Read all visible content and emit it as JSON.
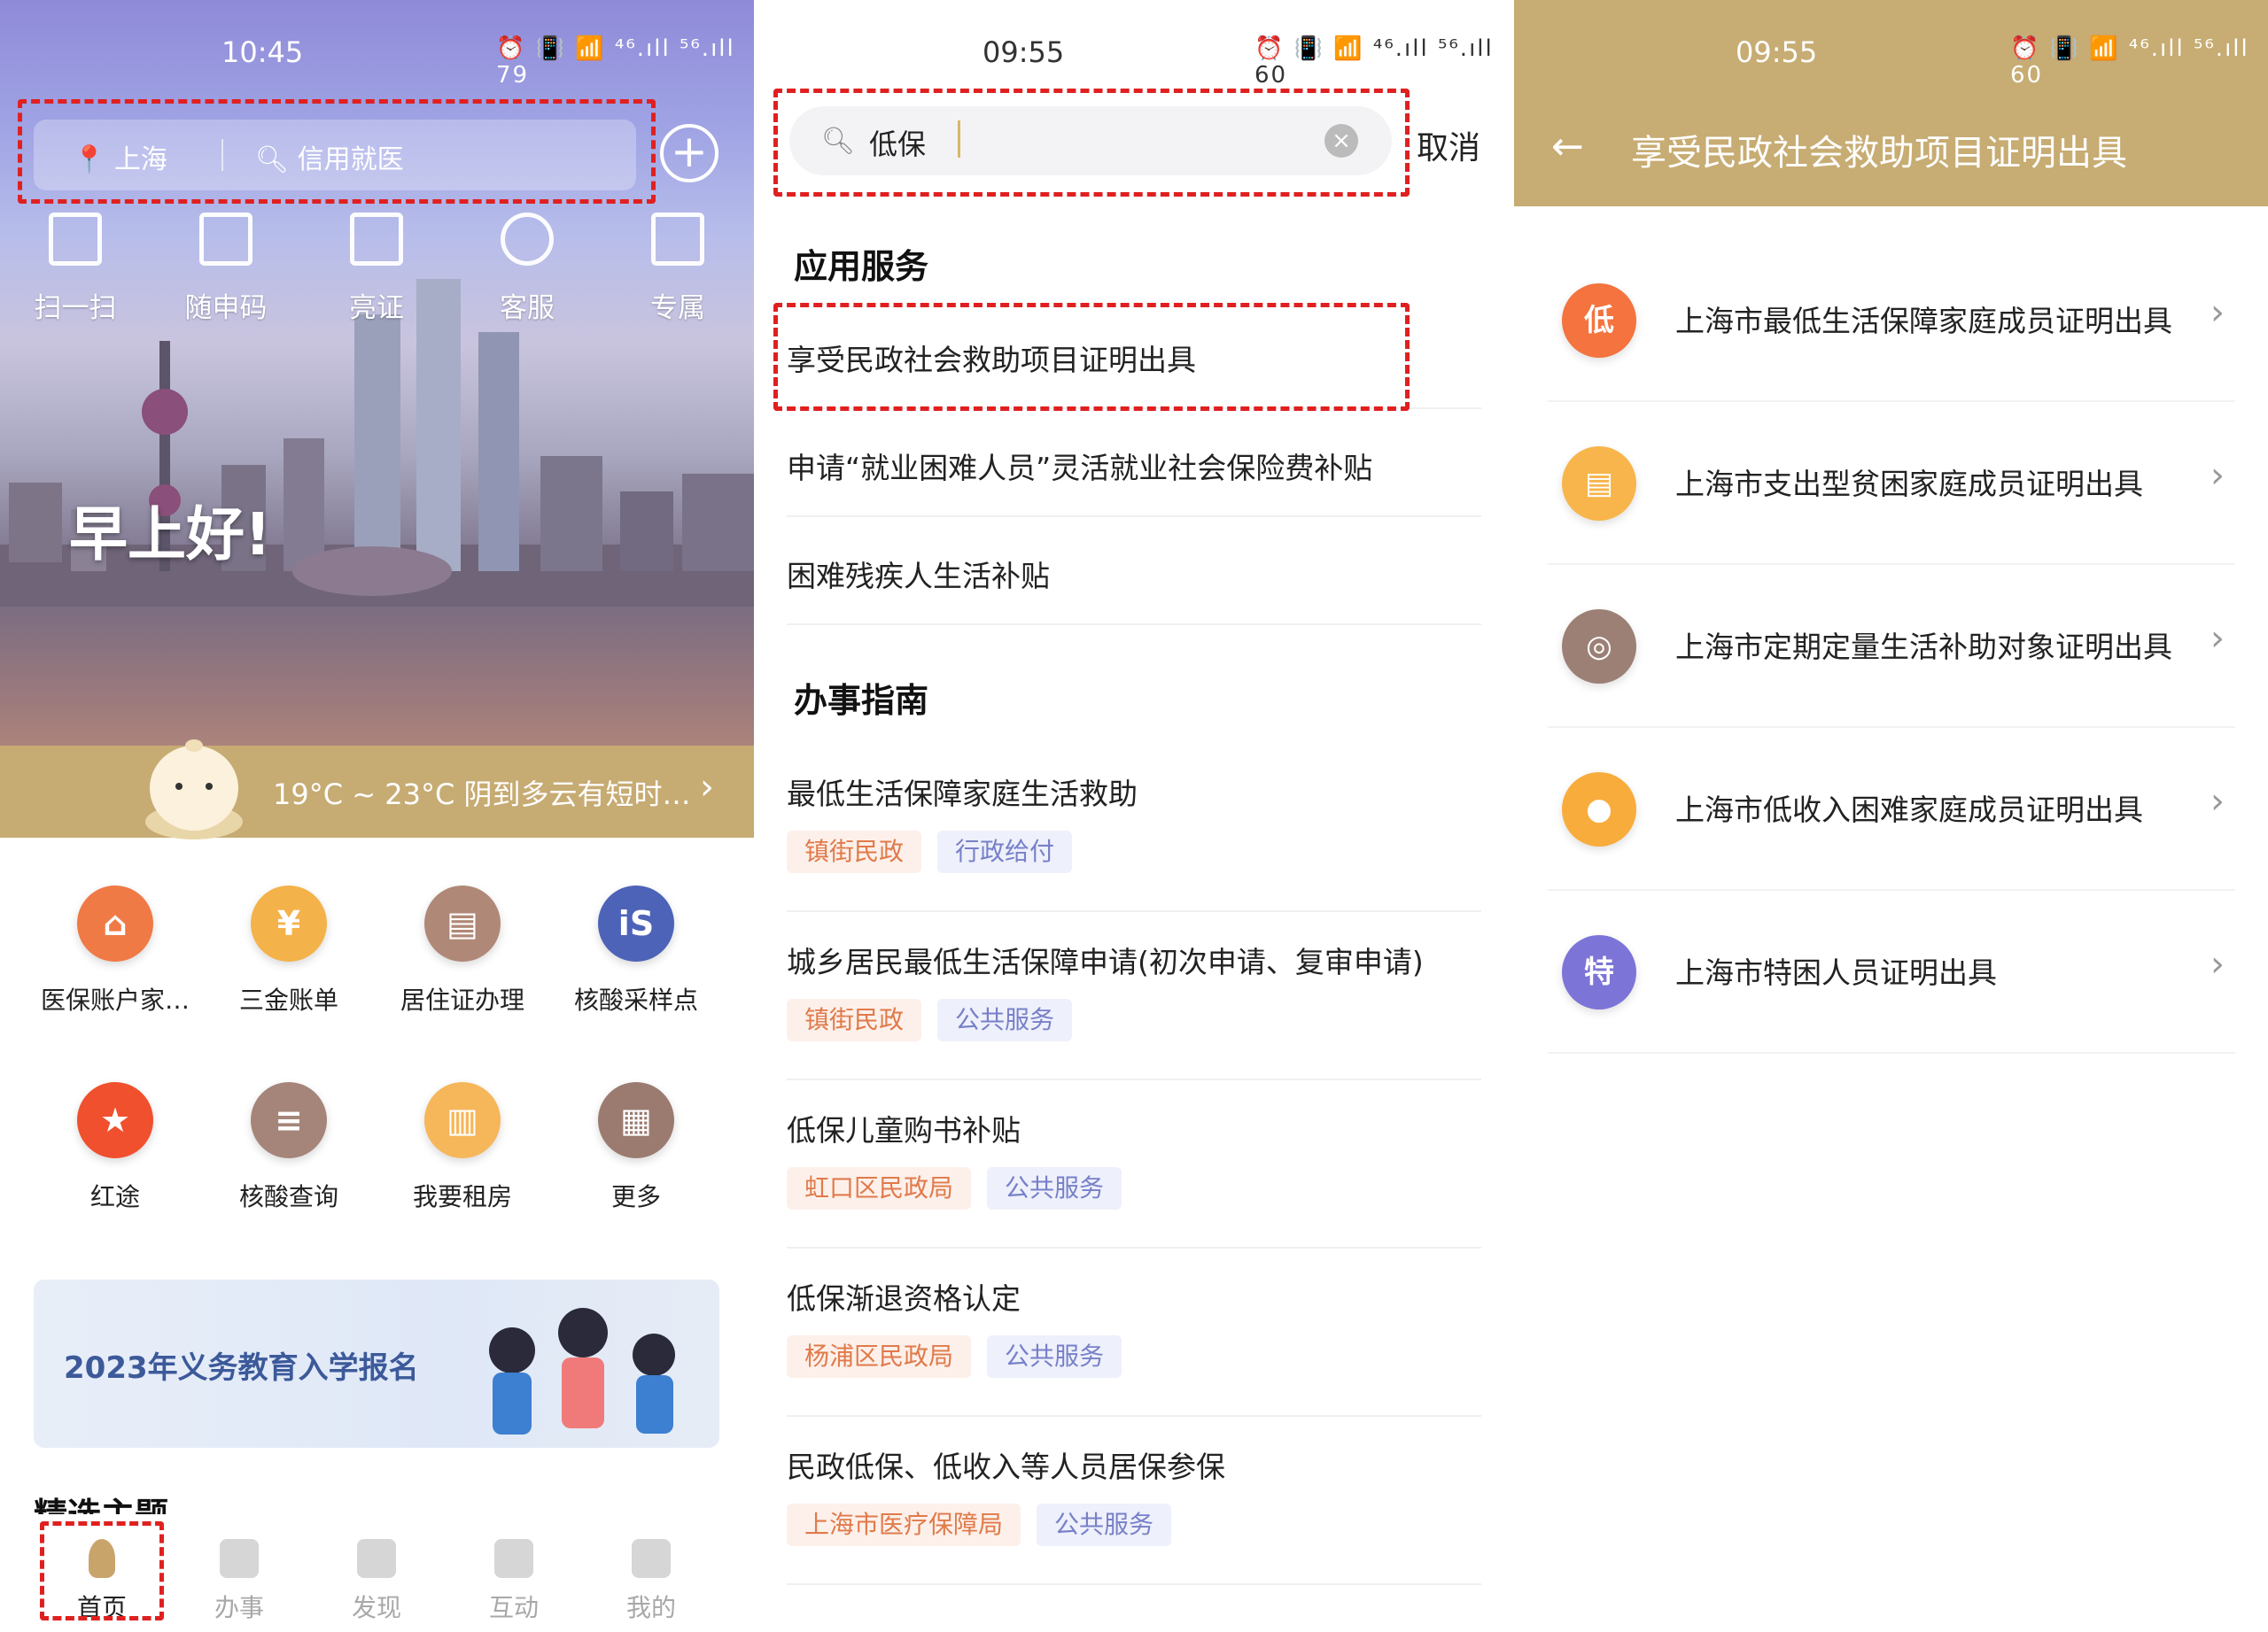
{
  "panel1": {
    "status_time": "10:45",
    "status_icons": "⏰ 📳 📶 ⁴⁶.ıll ⁵⁶.ıll 79",
    "search": {
      "location": "上海",
      "placeholder": "信用就医"
    },
    "quick_actions": [
      {
        "label": "扫一扫",
        "icon": "scan-icon"
      },
      {
        "label": "随申码",
        "icon": "qr-code-icon"
      },
      {
        "label": "亮证",
        "icon": "card-icon"
      },
      {
        "label": "客服",
        "icon": "headset-icon"
      },
      {
        "label": "专属",
        "icon": "crown-icon"
      }
    ],
    "greeting": "早上好!",
    "weather": "19°C ~ 23°C  阴到多云有短时…",
    "services": [
      {
        "label": "医保账户家…",
        "color": "#f07a45",
        "icon": "medical-insurance-icon"
      },
      {
        "label": "三金账单",
        "color": "#f4b24a",
        "icon": "yuan-house-icon"
      },
      {
        "label": "居住证办理",
        "color": "#b08878",
        "icon": "id-card-icon"
      },
      {
        "label": "核酸采样点",
        "color": "#4d63b8",
        "icon": "nucleic-test-icon"
      },
      {
        "label": "红途",
        "color": "#f0502d",
        "icon": "star-icon"
      },
      {
        "label": "核酸查询",
        "color": "#a5857a",
        "icon": "document-icon"
      },
      {
        "label": "我要租房",
        "color": "#f6b65a",
        "icon": "rent-icon"
      },
      {
        "label": "更多",
        "color": "#9b7b70",
        "icon": "grid-icon"
      }
    ],
    "banner_text": "2023年义务教育入学报名",
    "featured_title": "精选主题",
    "tabs": [
      {
        "label": "首页",
        "icon": "home-icon",
        "active": true
      },
      {
        "label": "办事",
        "icon": "brush-icon",
        "active": false
      },
      {
        "label": "发现",
        "icon": "arch-icon",
        "active": false
      },
      {
        "label": "互动",
        "icon": "flower-icon",
        "active": false
      },
      {
        "label": "我的",
        "icon": "person-icon",
        "active": false
      }
    ]
  },
  "panel2": {
    "status_time": "09:55",
    "status_icons": "⏰ 📳 📶 ⁴⁶.ıll ⁵⁶.ıll 60",
    "search_value": "低保",
    "cancel_label": "取消",
    "app_section_title": "应用服务",
    "app_results": [
      "享受民政社会救助项目证明出具",
      "申请“就业困难人员”灵活就业社会保险费补贴",
      "困难残疾人生活补贴"
    ],
    "guide_section_title": "办事指南",
    "guides": [
      {
        "title": "最低生活保障家庭生活救助",
        "tag1": "镇街民政",
        "tag2": "行政给付"
      },
      {
        "title": "城乡居民最低生活保障申请(初次申请、复审申请)",
        "tag1": "镇街民政",
        "tag2": "公共服务"
      },
      {
        "title": "低保儿童购书补贴",
        "tag1": "虹口区民政局",
        "tag2": "公共服务"
      },
      {
        "title": "低保渐退资格认定",
        "tag1": "杨浦区民政局",
        "tag2": "公共服务"
      },
      {
        "title": "民政低保、低收入等人员居保参保",
        "tag1": "上海市医疗保障局",
        "tag2": "公共服务"
      }
    ]
  },
  "panel3": {
    "status_time": "09:55",
    "status_icons": "⏰ 📳 📶 ⁴⁶.ıll ⁵⁶.ıll 60",
    "title": "享受民政社会救助项目证明出具",
    "items": [
      {
        "label": "上海市最低生活保障家庭成员证明出具",
        "color": "#f4733e",
        "glyph": "低",
        "icon": "minimum-living-house-icon"
      },
      {
        "label": "上海市支出型贫困家庭成员证明出具",
        "color": "#f8b54c",
        "glyph": "▤",
        "icon": "document-icon"
      },
      {
        "label": "上海市定期定量生活补助对象证明出具",
        "color": "#9c8076",
        "glyph": "◎",
        "icon": "coins-icon"
      },
      {
        "label": "上海市低收入困难家庭成员证明出具",
        "color": "#f8ac3c",
        "glyph": "●",
        "icon": "person-low-income-icon"
      },
      {
        "label": "上海市特困人员证明出具",
        "color": "#7c74d6",
        "glyph": "特",
        "icon": "person-special-icon"
      }
    ]
  }
}
